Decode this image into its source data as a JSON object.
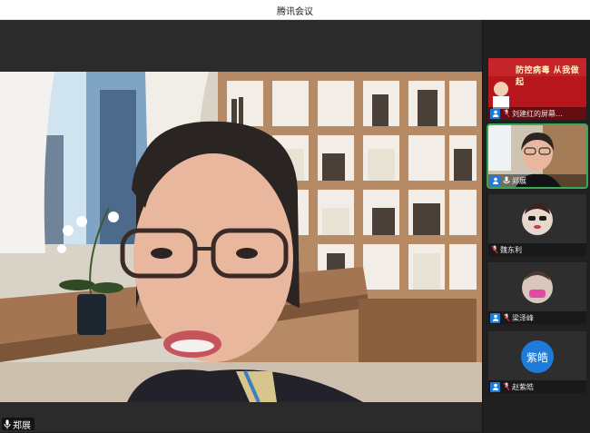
{
  "window": {
    "title": "腾讯会议"
  },
  "main_video": {
    "speaker_name": "郑展"
  },
  "participants": [
    {
      "label": "刘建红的屏幕…",
      "badge_icon": "person-badge-icon",
      "mic_icon": "mic-muted-icon",
      "type": "screen-share"
    },
    {
      "label": "郑展",
      "badge_icon": "person-badge-icon",
      "mic_icon": "mic-icon",
      "type": "camera",
      "active": true
    },
    {
      "label": "魏东利",
      "mic_icon": "mic-muted-icon",
      "type": "camera"
    },
    {
      "label": "梁泽峰",
      "badge_icon": "person-badge-icon",
      "mic_icon": "mic-muted-icon",
      "type": "camera"
    },
    {
      "label": "赵紫皓",
      "avatar_text": "紫皓",
      "badge_icon": "person-badge-icon",
      "mic_icon": "mic-muted-icon",
      "type": "avatar"
    }
  ],
  "screen_share_banner": {
    "text": "防控病毒 从我做起"
  },
  "colors": {
    "accent": "#1e7bd9",
    "active_border": "#3aa857",
    "muted": "#d93030"
  }
}
